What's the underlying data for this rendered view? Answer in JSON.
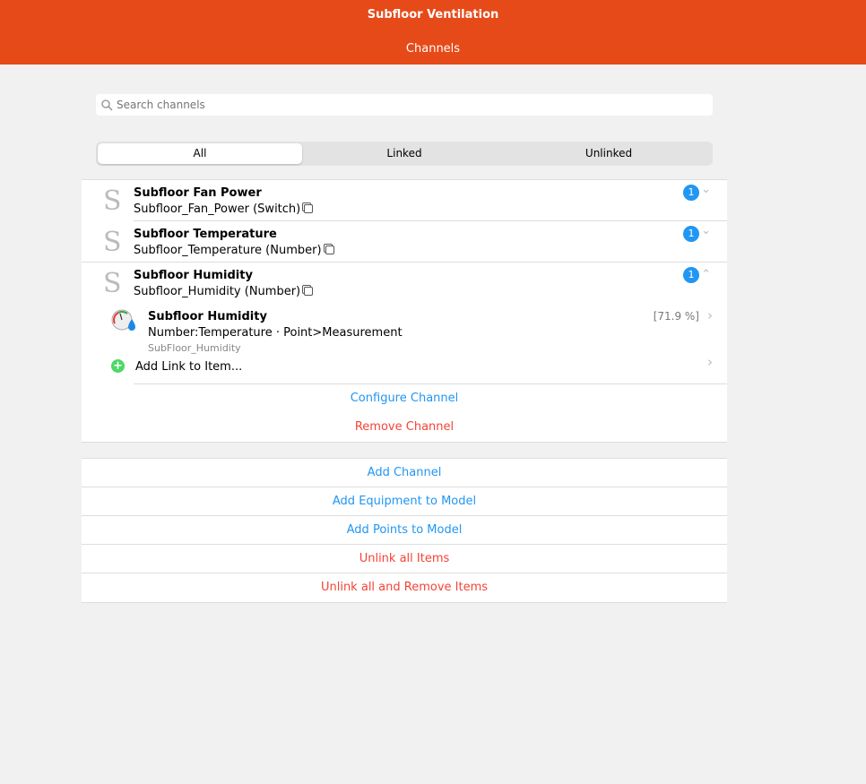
{
  "header": {
    "title": "Subfloor Ventilation",
    "subtitle": "Channels"
  },
  "search": {
    "placeholder": "Search channels"
  },
  "filter": {
    "tabs": [
      "All",
      "Linked",
      "Unlinked"
    ],
    "selected": "All"
  },
  "channels": [
    {
      "name": "Subfloor Fan Power",
      "id": "Subfloor_Fan_Power (Switch)",
      "links": "1",
      "expanded": false
    },
    {
      "name": "Subfloor Temperature",
      "id": "Subfloor_Temperature (Number)",
      "links": "1",
      "expanded": false
    },
    {
      "name": "Subfloor Humidity",
      "id": "Subfloor_Humidity (Number)",
      "links": "1",
      "expanded": true
    }
  ],
  "linked_item": {
    "label": "Subfloor Humidity",
    "type": "Number:Temperature · Point>Measurement",
    "name": "SubFloor_Humidity",
    "state": "[71.9 %]"
  },
  "expanded_actions": {
    "add_link": "Add Link to Item...",
    "configure": "Configure Channel",
    "remove": "Remove Channel"
  },
  "actions": [
    {
      "label": "Add Channel",
      "color": "blue"
    },
    {
      "label": "Add Equipment to Model",
      "color": "blue"
    },
    {
      "label": "Add Points to Model",
      "color": "blue"
    },
    {
      "label": "Unlink all Items",
      "color": "red"
    },
    {
      "label": "Unlink all and Remove Items",
      "color": "red"
    }
  ],
  "colors": {
    "brand": "#e64a19",
    "accent": "#2196f3",
    "danger": "#f44336"
  }
}
